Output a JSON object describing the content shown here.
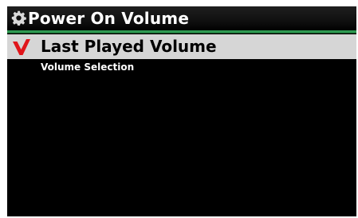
{
  "title_bar": {
    "icon": "gear-icon",
    "title": "Power On Volume"
  },
  "list": {
    "items": [
      {
        "label": "Last Played Volume",
        "selected": true,
        "icon": "check-icon",
        "check_color": "#e0161b"
      }
    ],
    "subtitle": "Volume Selection"
  },
  "colors": {
    "accent_line": "#2f9a52",
    "selected_row": "#d6d6d6",
    "background": "#000000"
  }
}
